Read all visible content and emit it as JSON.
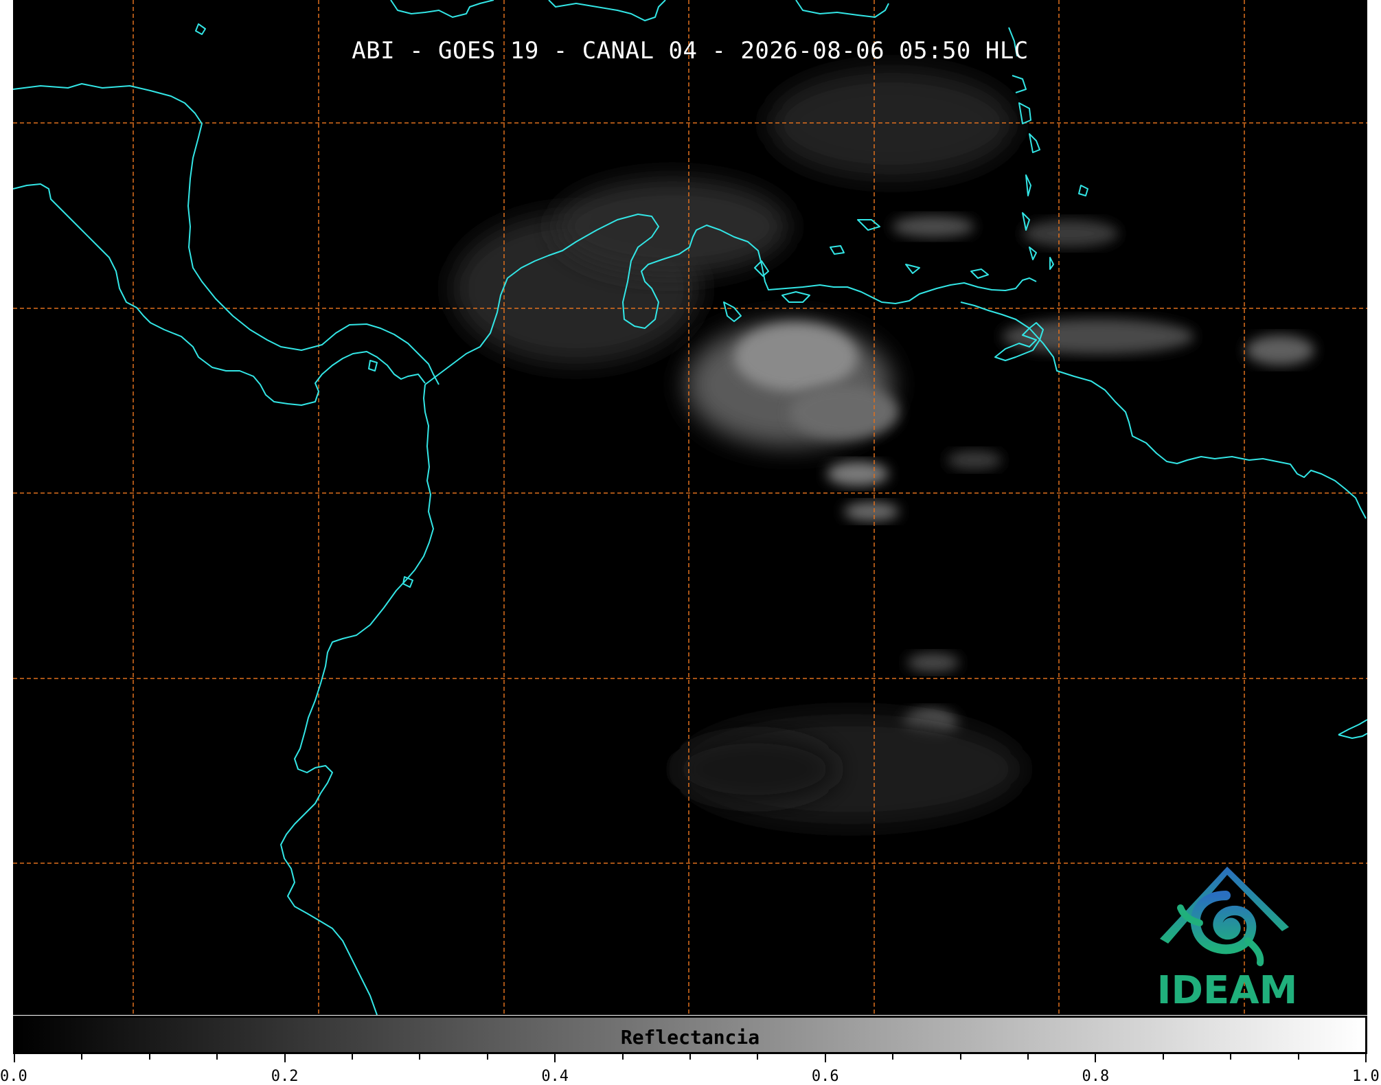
{
  "map": {
    "title": "ABI - GOES 19 - CANAL 04 - 2026-08-06 05:50 HLC",
    "background_color": "#000000",
    "coastline_color": "#33e6e6",
    "gridline_color": "#e0701e",
    "gridline_style": "dashed"
  },
  "logo": {
    "text": "IDEAM",
    "icon": "ideam-mountain-swirl-logo",
    "colors": [
      "#2a6fc0",
      "#20b07c"
    ]
  },
  "colorbar": {
    "label": "Reflectancia",
    "range": [
      0.0,
      1.0
    ],
    "gradient": [
      "#000000",
      "#ffffff"
    ],
    "tick_labels": [
      "0.0",
      "0.2",
      "0.4",
      "0.6",
      "0.8",
      "1.0"
    ]
  }
}
